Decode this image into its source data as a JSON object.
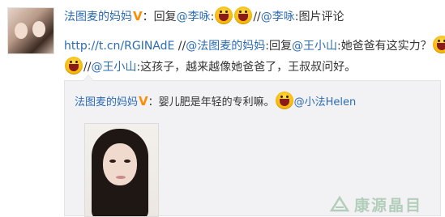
{
  "post": {
    "line1": {
      "author": "法图麦的妈妈",
      "verified_mark": "V",
      "colon": "：",
      "reply1": "回复",
      "mention1": "@李咏",
      "sep1": ":",
      "sep2": "//",
      "mention2": "@李咏",
      "sep3": ":",
      "text": "图片评论"
    },
    "line2": {
      "link": "http://t.cn/RGINAdE",
      "sep": " //",
      "mention1": "@法图麦的妈妈",
      "sep2": ":",
      "reply": "回复",
      "mention2": "@王小山",
      "sep3": ":",
      "text": "她爸爸有这实力？"
    },
    "line3": {
      "sep": "//",
      "mention": "@王小山",
      "sep2": ":",
      "text": "这孩子，越来越像她爸爸了，王叔叔问好。"
    }
  },
  "quote": {
    "author": "法图麦的妈妈",
    "verified_mark": "V",
    "colon": "：",
    "text": "婴儿肥是年轻的专利嘛。",
    "mention": "@小法Helen"
  },
  "watermark": {
    "text": "康源晶目"
  },
  "colors": {
    "link": "#2b6bb1",
    "verified": "#ff8c00",
    "quote_bg": "#f2f2f5"
  },
  "icons": [
    "avatar",
    "laughing-emoji-icon",
    "verified-v-icon",
    "photo-thumbnail",
    "watermark-logo-icon"
  ]
}
